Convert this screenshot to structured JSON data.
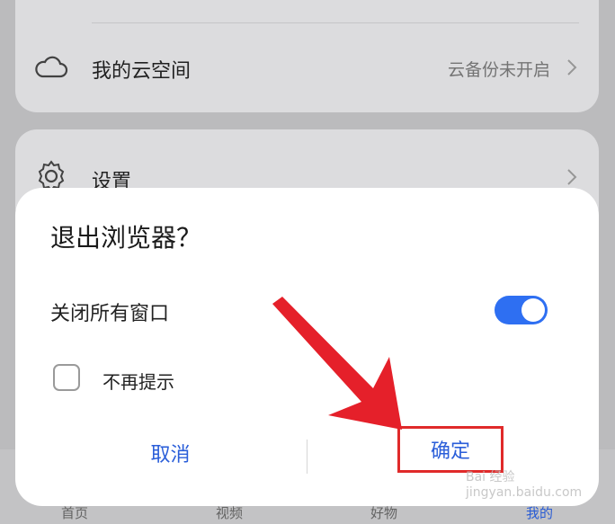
{
  "cloud": {
    "label": "我的云空间",
    "value": "云备份未开启"
  },
  "settings": {
    "label": "设置"
  },
  "bottom_nav": [
    {
      "label": "首页"
    },
    {
      "label": "视频"
    },
    {
      "label": "好物"
    },
    {
      "label": "我的"
    }
  ],
  "dialog": {
    "title": "退出浏览器？",
    "option_label": "关闭所有窗口",
    "toggle_on": true,
    "checkbox_label": "不再提示",
    "cancel_label": "取消",
    "confirm_label": "确定"
  },
  "watermark": "Bai 经验 jingyan.baidu.com",
  "colors": {
    "accent": "#2e6ff2",
    "annotation": "#e02a2a"
  }
}
